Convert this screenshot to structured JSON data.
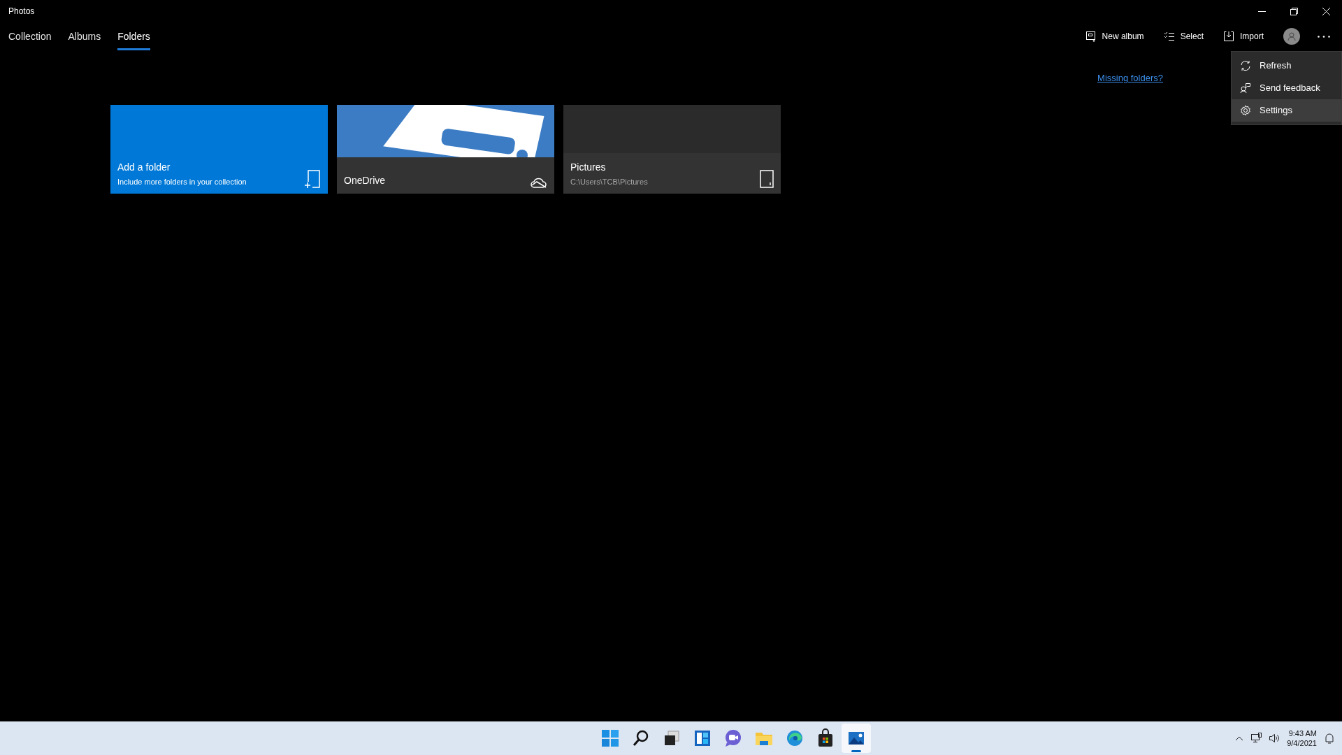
{
  "window": {
    "title": "Photos"
  },
  "tabs": [
    {
      "label": "Collection",
      "selected": false
    },
    {
      "label": "Albums",
      "selected": false
    },
    {
      "label": "Folders",
      "selected": true
    }
  ],
  "toolbar": [
    {
      "kind": "new-album",
      "label": "New album"
    },
    {
      "kind": "select",
      "label": "Select"
    },
    {
      "kind": "import",
      "label": "Import"
    },
    {
      "kind": "account"
    },
    {
      "kind": "more"
    }
  ],
  "missing_folders_link": "Missing folders?",
  "menu": [
    {
      "kind": "refresh",
      "label": "Refresh",
      "highlighted": false
    },
    {
      "kind": "feedback",
      "label": "Send feedback",
      "highlighted": false
    },
    {
      "kind": "settings",
      "label": "Settings",
      "highlighted": true
    }
  ],
  "tiles": [
    {
      "kind": "add",
      "title": "Add a folder",
      "subtitle": "Include more folders in your collection"
    },
    {
      "kind": "onedrive",
      "title": "OneDrive"
    },
    {
      "kind": "folder",
      "title": "Pictures",
      "subtitle": "C:\\Users\\TCB\\Pictures"
    }
  ],
  "taskbar": {
    "apps": [
      {
        "kind": "start",
        "active": false
      },
      {
        "kind": "search",
        "active": false
      },
      {
        "kind": "taskview",
        "active": false
      },
      {
        "kind": "widgets",
        "active": false
      },
      {
        "kind": "chat",
        "active": false
      },
      {
        "kind": "explorer",
        "active": false
      },
      {
        "kind": "edge",
        "active": false
      },
      {
        "kind": "store",
        "active": false
      },
      {
        "kind": "photos",
        "active": true
      }
    ],
    "time": "9:43 AM",
    "date": "9/4/2021"
  }
}
